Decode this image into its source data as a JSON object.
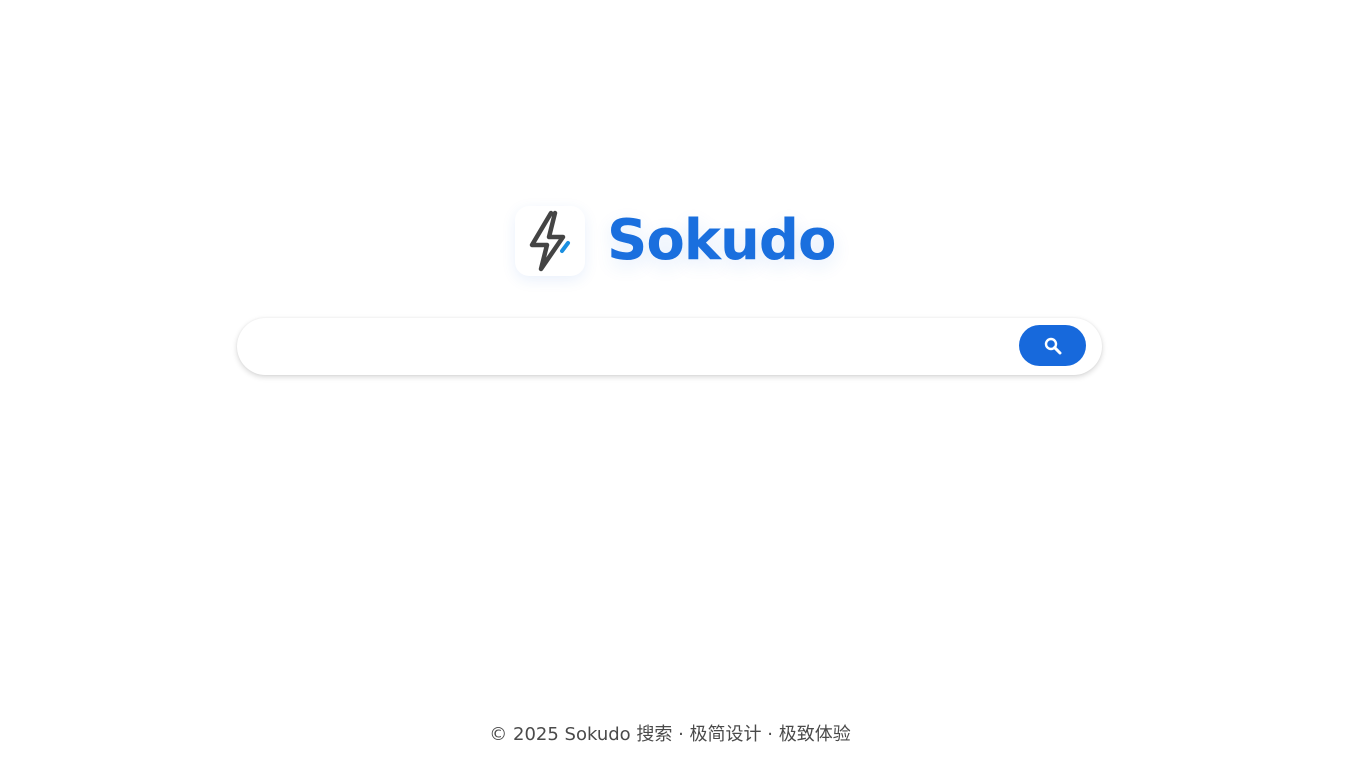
{
  "brand": {
    "name": "Sokudo",
    "logo_icon": "lightning-bolt-icon",
    "accent_color": "#1a6fde"
  },
  "search": {
    "value": "",
    "placeholder": "",
    "button_icon": "search-icon",
    "button_color": "#1769dc"
  },
  "footer": {
    "text": "© 2025 Sokudo 搜索 · 极简设计 · 极致体验"
  }
}
